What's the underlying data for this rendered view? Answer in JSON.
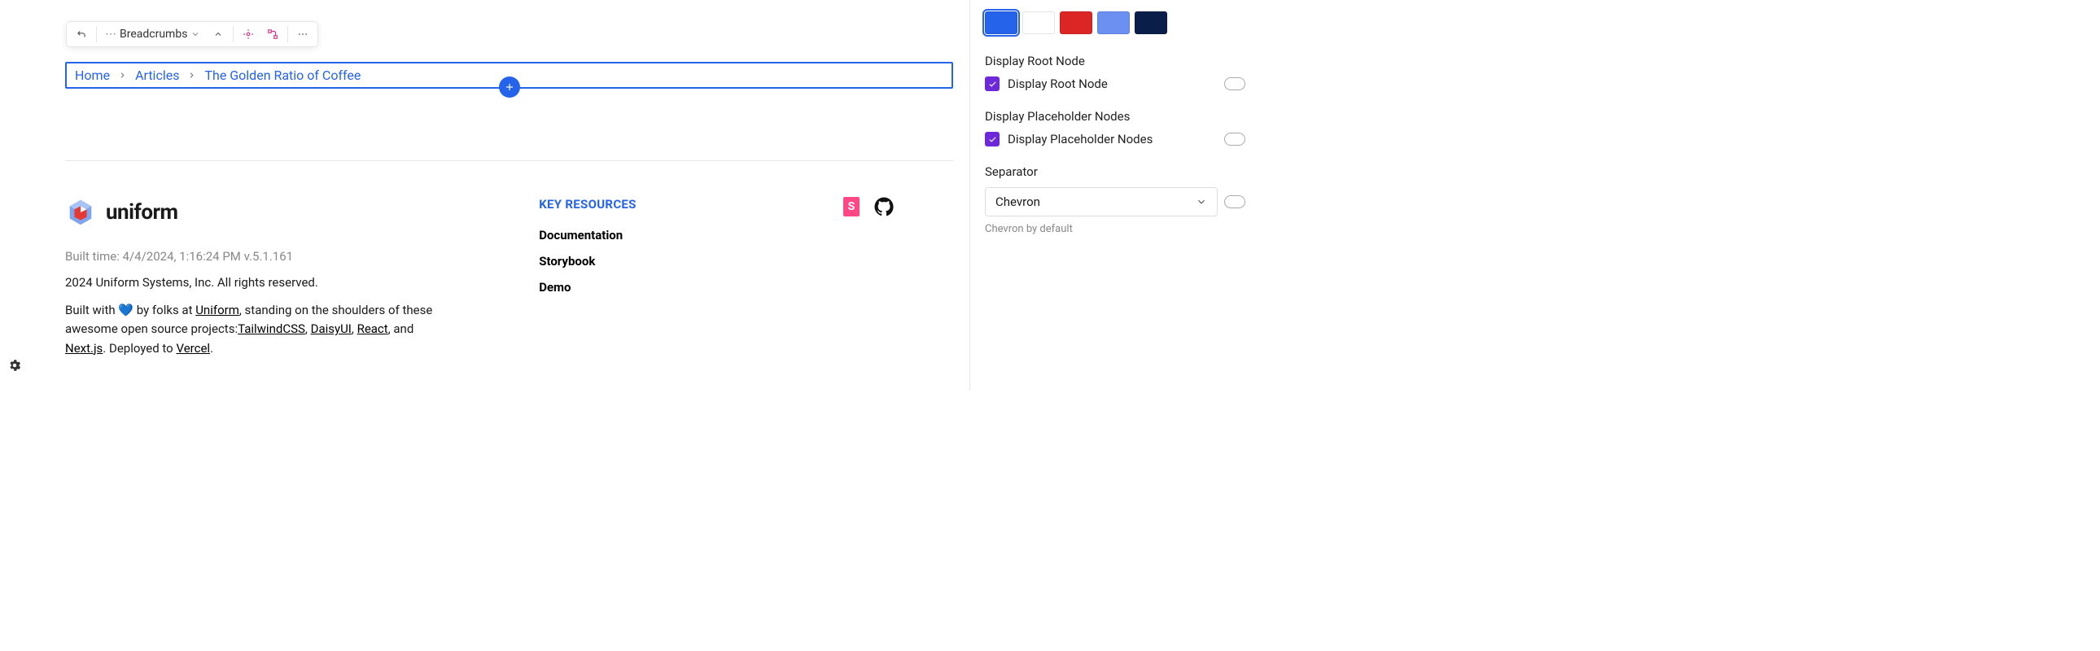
{
  "toolbar": {
    "label": "Breadcrumbs"
  },
  "breadcrumbs": {
    "items": [
      "Home",
      "Articles",
      "The Golden Ratio of Coffee"
    ]
  },
  "footer": {
    "logo_text": "uniform",
    "build_time": "Built time: 4/4/2024, 1:16:24 PM v.5.1.161",
    "copyright": "2024 Uniform Systems, Inc. All rights reserved.",
    "credits_prefix": "Built with ",
    "credits_by": " by folks at ",
    "uniform": "Uniform",
    "credits_mid": ", standing on the shoulders of these awesome open source projects:",
    "tailwind": "TailwindCSS",
    "daisy": "DaisyUI",
    "react": "React",
    "and": ", and ",
    "next": "Next.js",
    "deployed": ". Deployed to ",
    "vercel": "Vercel",
    "period": ".",
    "comma": ", ",
    "key_title": "KEY RESOURCES",
    "links": [
      "Documentation",
      "Storybook",
      "Demo"
    ],
    "storybook_badge": "S"
  },
  "sidebar": {
    "swatches": [
      "#2563eb",
      "#ffffff",
      "#dc2626",
      "#6c8ff2",
      "#0a1e4a"
    ],
    "selected_swatch": 0,
    "root_label": "Display Root Node",
    "root_check_label": "Display Root Node",
    "placeholder_label": "Display Placeholder Nodes",
    "placeholder_check_label": "Display Placeholder Nodes",
    "separator_label": "Separator",
    "separator_value": "Chevron",
    "separator_helper": "Chevron by default"
  }
}
